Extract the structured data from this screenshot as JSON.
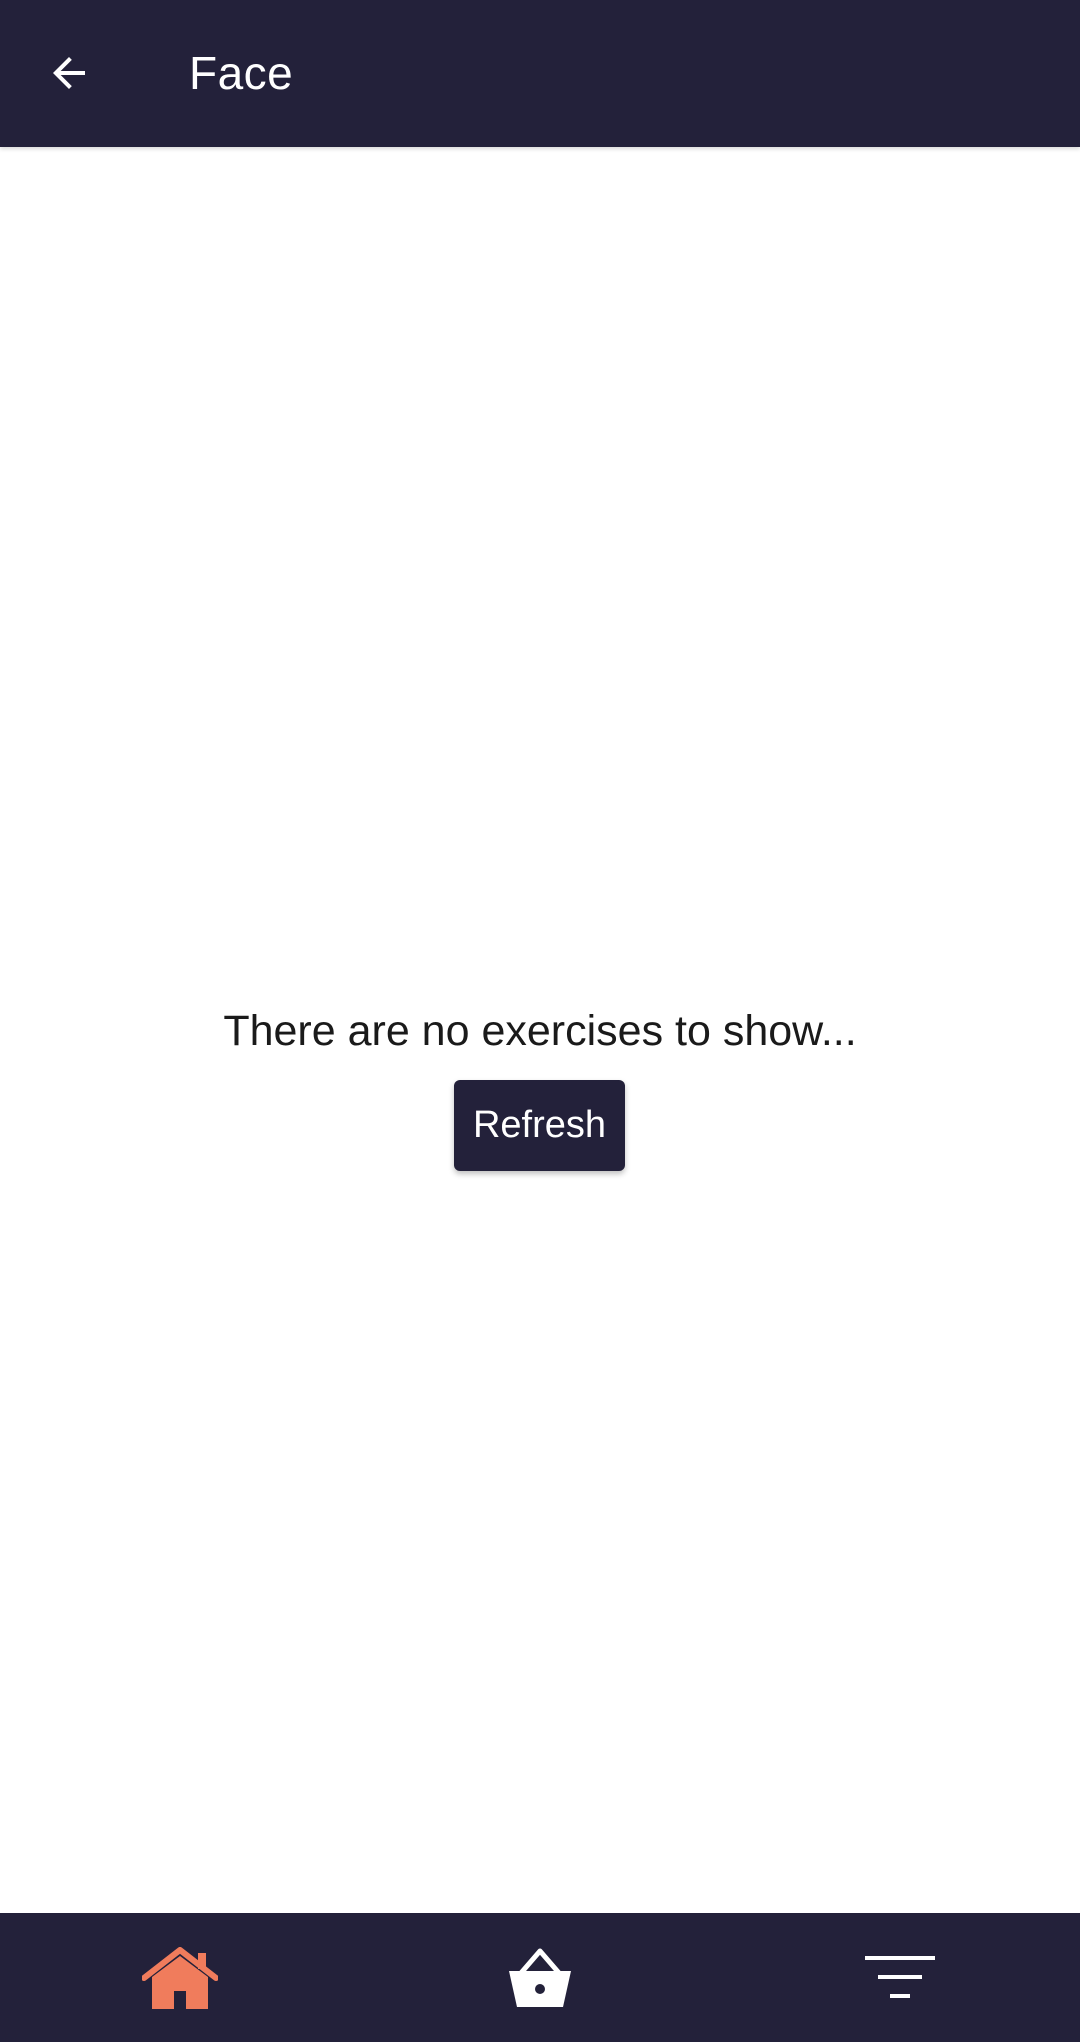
{
  "app_bar": {
    "title": "Face",
    "back_icon": "arrow-left-icon"
  },
  "main": {
    "empty_message": "There are no exercises to show...",
    "refresh_label": "Refresh"
  },
  "bottom_nav": {
    "items": [
      {
        "name": "home",
        "icon": "home-icon",
        "active": true
      },
      {
        "name": "basket",
        "icon": "basket-icon",
        "active": false
      },
      {
        "name": "filter",
        "icon": "filter-icon",
        "active": false
      }
    ]
  },
  "colors": {
    "primary": "#23213a",
    "accent": "#f07c5c",
    "background": "#ffffff",
    "on_primary": "#ffffff"
  }
}
